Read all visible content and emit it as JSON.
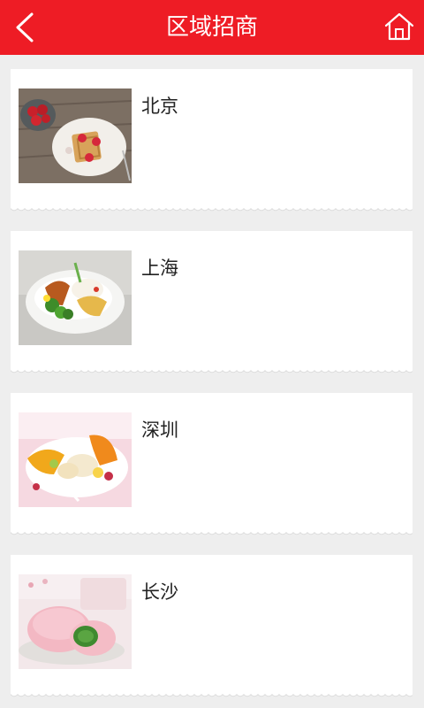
{
  "header": {
    "title": "区域招商"
  },
  "regions": [
    {
      "name": "北京",
      "image": "waffle-strawberry-photo"
    },
    {
      "name": "上海",
      "image": "rice-bowl-photo"
    },
    {
      "name": "深圳",
      "image": "fruit-dessert-photo"
    },
    {
      "name": "长沙",
      "image": "mochi-photo"
    }
  ],
  "colors": {
    "header": "#ee1c25",
    "background": "#eeeeee",
    "card": "#ffffff"
  }
}
